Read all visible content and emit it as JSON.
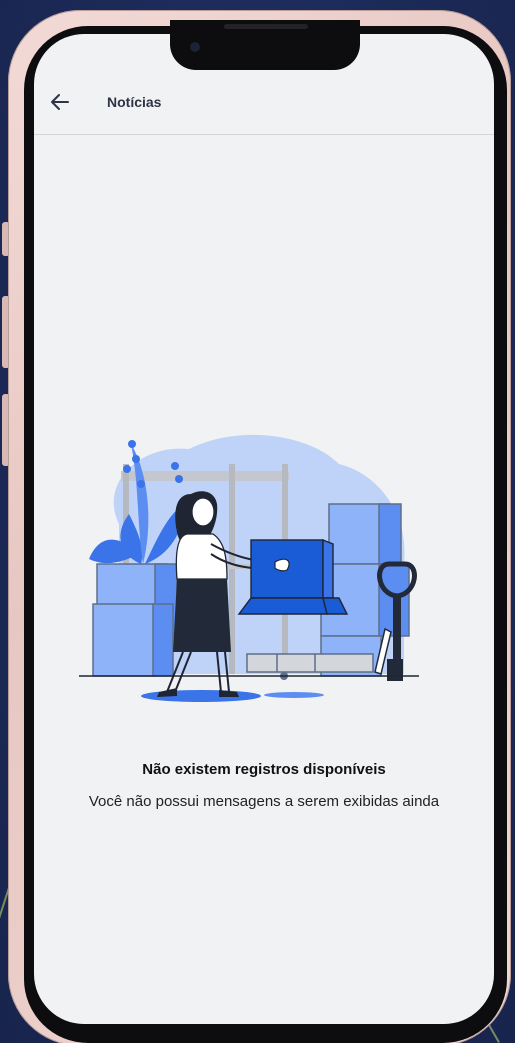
{
  "header": {
    "title": "Notícias",
    "back_icon": "arrow-left-icon"
  },
  "empty_state": {
    "illustration": "woman-carrying-box-warehouse-illustration",
    "title": "Não existem registros disponíveis",
    "message": "Você não possui mensagens a serem exibidas ainda"
  },
  "colors": {
    "background": "#1f2d5c",
    "screen": "#f1f2f4",
    "accent_blue": "#1a5bd6",
    "light_blue": "#a9c5fa",
    "phone_frame": "#ecd0cb"
  }
}
